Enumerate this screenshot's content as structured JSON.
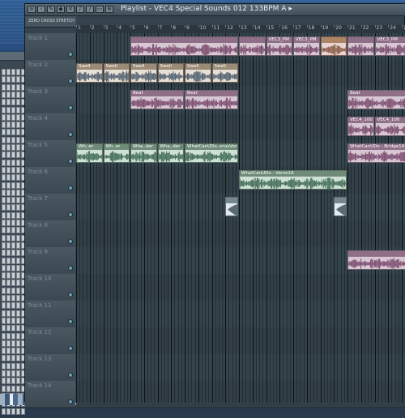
{
  "window": {
    "title": "Playlist - VEC4 Special Sounds 012 133BPM A",
    "title_arrow": "▸"
  },
  "toolbar": {
    "left_label": "ZERO CROSS",
    "right_label": "STRETCH"
  },
  "ruler_numbers": [
    "1",
    "2",
    "3",
    "4",
    "5",
    "6",
    "7",
    "8",
    "9",
    "10",
    "11",
    "12",
    "13",
    "14",
    "15",
    "16",
    "17",
    "18",
    "19",
    "20",
    "21",
    "22",
    "23",
    "24",
    "25"
  ],
  "tracks": [
    {
      "label": "Track 1"
    },
    {
      "label": "Track 2"
    },
    {
      "label": "Track 3"
    },
    {
      "label": "Track 4"
    },
    {
      "label": "Track 5"
    },
    {
      "label": "Track 6"
    },
    {
      "label": "Track 7"
    },
    {
      "label": "Track 8"
    },
    {
      "label": "Track 9"
    },
    {
      "label": "Track 10"
    },
    {
      "label": "Track 11"
    },
    {
      "label": "Track 12"
    },
    {
      "label": "Track 13"
    },
    {
      "label": "Track 14"
    }
  ],
  "clips": [
    {
      "track": 0,
      "start": 5,
      "len": 8,
      "label": "",
      "color": "pink"
    },
    {
      "track": 0,
      "start": 13,
      "len": 2,
      "label": "",
      "color": "pink"
    },
    {
      "track": 0,
      "start": 15,
      "len": 2,
      "label": "VEC3_PM",
      "color": "pink"
    },
    {
      "track": 0,
      "start": 17,
      "len": 2,
      "label": "VEC3_PM",
      "color": "pink"
    },
    {
      "track": 0,
      "start": 19,
      "len": 2,
      "label": "",
      "color": "orange"
    },
    {
      "track": 0,
      "start": 21,
      "len": 2,
      "label": "",
      "color": "pink"
    },
    {
      "track": 0,
      "start": 23,
      "len": 3,
      "label": "VEC3_PM",
      "color": "pink"
    },
    {
      "track": 1,
      "start": 1,
      "len": 2,
      "label": "Swell",
      "color": "tan"
    },
    {
      "track": 1,
      "start": 3,
      "len": 2,
      "label": "Swell",
      "color": "tan"
    },
    {
      "track": 1,
      "start": 5,
      "len": 2,
      "label": "Swell",
      "color": "tan"
    },
    {
      "track": 1,
      "start": 7,
      "len": 2,
      "label": "Swell",
      "color": "tan"
    },
    {
      "track": 1,
      "start": 9,
      "len": 2,
      "label": "Swell",
      "color": "tan"
    },
    {
      "track": 1,
      "start": 11,
      "len": 2,
      "label": "Swell",
      "color": "tan"
    },
    {
      "track": 2,
      "start": 5,
      "len": 4,
      "label": "Beat",
      "color": "pink"
    },
    {
      "track": 2,
      "start": 9,
      "len": 4,
      "label": "Beat",
      "color": "pink"
    },
    {
      "track": 2,
      "start": 21,
      "len": 5,
      "label": "Beat",
      "color": "pink"
    },
    {
      "track": 3,
      "start": 21,
      "len": 2,
      "label": "VEC4_100",
      "color": "pink"
    },
    {
      "track": 3,
      "start": 23,
      "len": 3,
      "label": "VEC4_100",
      "color": "pink"
    },
    {
      "track": 4,
      "start": 1,
      "len": 2,
      "label": "Wh..er",
      "color": "green"
    },
    {
      "track": 4,
      "start": 3,
      "len": 2,
      "label": "Wh..er",
      "color": "green"
    },
    {
      "track": 4,
      "start": 5,
      "len": 2,
      "label": "Wha..der",
      "color": "green"
    },
    {
      "track": 4,
      "start": 7,
      "len": 2,
      "label": "Wha..der",
      "color": "green"
    },
    {
      "track": 4,
      "start": 9,
      "len": 4,
      "label": "WhatCanUDo..orusVocoder",
      "color": "green"
    },
    {
      "track": 4,
      "start": 21,
      "len": 5,
      "label": "WhatCanUDo - Bridge1A",
      "color": "pink"
    },
    {
      "track": 5,
      "start": 13,
      "len": 8,
      "label": "WhatCanUDo - Verse1A",
      "color": "green"
    },
    {
      "track": 6,
      "start": 12,
      "len": 1,
      "label": "",
      "color": "lite"
    },
    {
      "track": 6,
      "start": 20,
      "len": 1,
      "label": "",
      "color": "lite"
    },
    {
      "track": 8,
      "start": 21,
      "len": 5,
      "label": "",
      "color": "pink"
    }
  ]
}
